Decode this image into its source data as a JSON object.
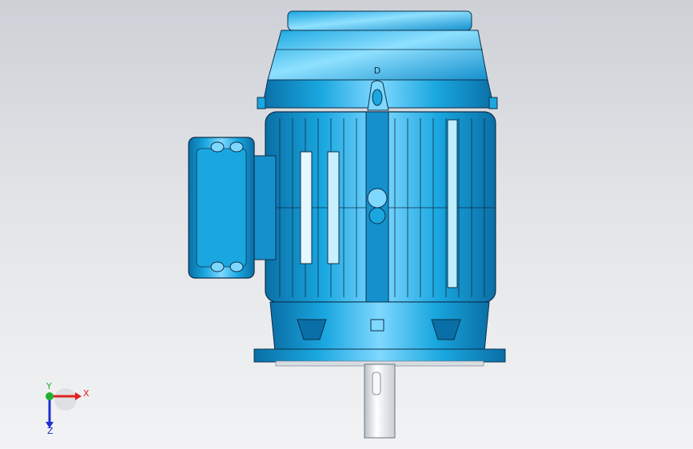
{
  "viewport": {
    "background_top": "#cdd0d6",
    "background_bottom": "#f2f3f4"
  },
  "model": {
    "part_color": "#1aa7e0",
    "part_highlight": "#7fd8ff",
    "part_shadow": "#0a6fa6",
    "edge_color": "#0d2f4a",
    "shaft_color": "#e8ecef",
    "nameplate_letter": "D"
  },
  "triad": {
    "x_label": "X",
    "y_label": "Y",
    "z_label": "Z",
    "x_color": "#e02020",
    "y_color": "#20b030",
    "z_color": "#2030d0"
  }
}
